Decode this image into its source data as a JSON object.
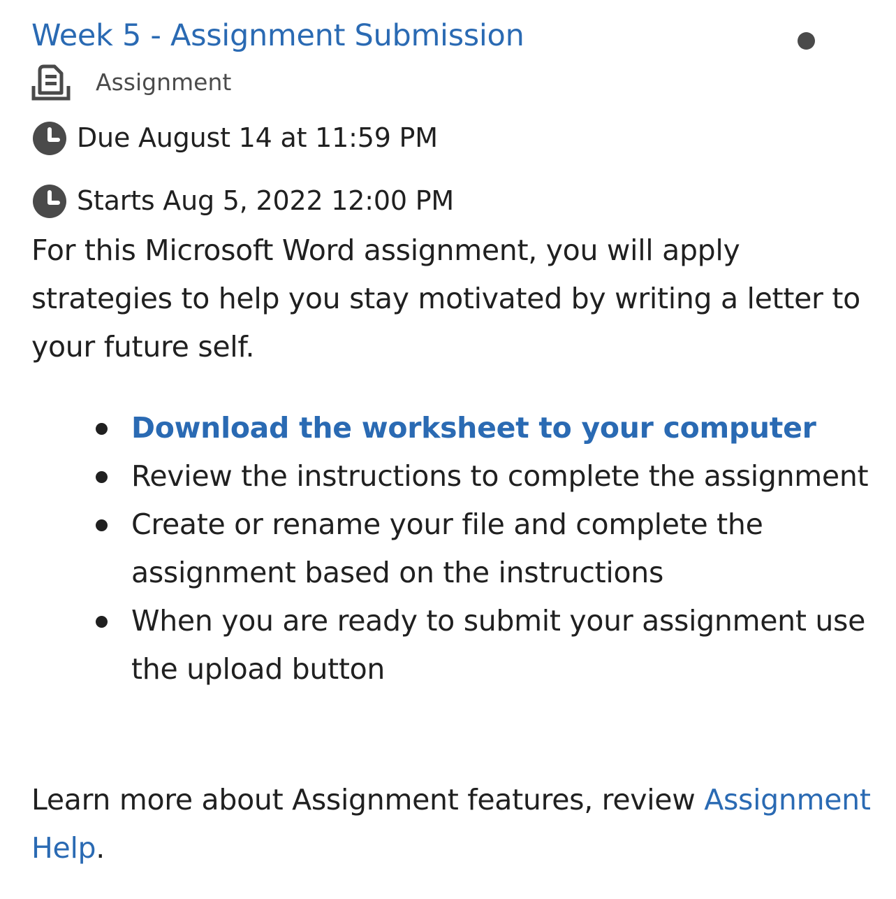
{
  "header": {
    "title": "Week 5 - Assignment Submission",
    "type_label": "Assignment",
    "type_icon": "assignment-icon",
    "unread_indicator": "dot"
  },
  "dates": {
    "due": "Due August 14 at 11:59 PM",
    "starts": "Starts Aug 5, 2022 12:00 PM",
    "icon": "clock-icon"
  },
  "description": "For this Microsoft Word assignment, you will apply strategies to help you stay motivated by writing a letter to your future self.",
  "steps": [
    {
      "text": "Download the worksheet to your computer",
      "is_link": true
    },
    {
      "text": "Review the instructions to complete the assignment",
      "is_link": false
    },
    {
      "text": "Create or rename your file and complete the assignment based on the instructions",
      "is_link": false
    },
    {
      "text": "When you are ready to submit your assignment use the upload button",
      "is_link": false
    }
  ],
  "help": {
    "prefix": "Learn more about Assignment features, review ",
    "link_text": "Assignment Help",
    "suffix": "."
  },
  "colors": {
    "link": "#2a6ab3",
    "text": "#202020",
    "icon": "#4a4a4a"
  }
}
